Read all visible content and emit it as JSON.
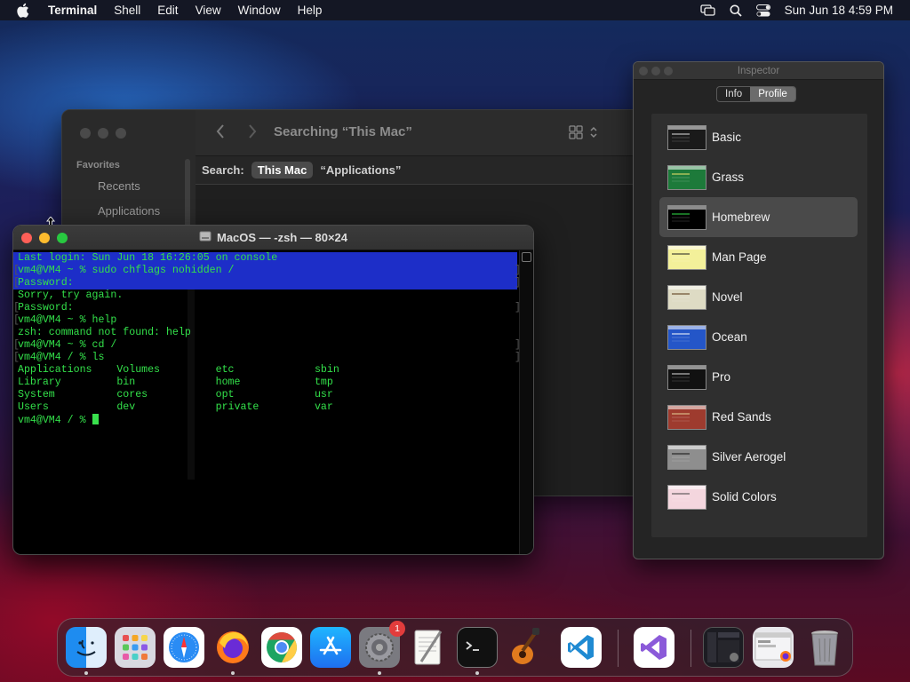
{
  "menubar": {
    "app_name": "Terminal",
    "items": [
      "Shell",
      "Edit",
      "View",
      "Window",
      "Help"
    ],
    "clock": "Sun Jun 18  4:59 PM"
  },
  "finder": {
    "title": "Searching “This Mac”",
    "sidebar_section": "Favorites",
    "sidebar_items": [
      "Recents",
      "Applications"
    ],
    "search_label": "Search:",
    "scope_selected": "This Mac",
    "scope_other": "“Applications”"
  },
  "terminal": {
    "title": "MacOS — -zsh — 80×24",
    "lines": [
      "Last login: Sun Jun 18 16:26:05 on console",
      "vm4@VM4 ~ % sudo chflags nohidden /",
      "Password:",
      "Sorry, try again.",
      "Password:",
      "vm4@VM4 ~ % help",
      "zsh: command not found: help",
      "vm4@VM4 ~ % cd /",
      "vm4@VM4 / % ls",
      "Applications    Volumes         etc             sbin",
      "Library         bin             home            tmp",
      "System          cores           opt             usr",
      "Users           dev             private         var",
      "vm4@VM4 / % "
    ],
    "selected_lines": [
      0,
      1,
      2
    ]
  },
  "inspector": {
    "title": "Inspector",
    "tabs": [
      "Info",
      "Profile"
    ],
    "active_tab": "Profile",
    "selected_profile": "Homebrew",
    "profiles": [
      {
        "name": "Basic",
        "bg": "#1a1a1a",
        "fg": "#e0e0e0"
      },
      {
        "name": "Grass",
        "bg": "#1d7a3a",
        "fg": "#f2e56b"
      },
      {
        "name": "Homebrew",
        "bg": "#000000",
        "fg": "#33e14a"
      },
      {
        "name": "Man Page",
        "bg": "#f3f09a",
        "fg": "#222222"
      },
      {
        "name": "Novel",
        "bg": "#dedbc4",
        "fg": "#553311"
      },
      {
        "name": "Ocean",
        "bg": "#2456c8",
        "fg": "#ffffff"
      },
      {
        "name": "Pro",
        "bg": "#111111",
        "fg": "#dddddd"
      },
      {
        "name": "Red Sands",
        "bg": "#9e3b2e",
        "fg": "#e6d39a"
      },
      {
        "name": "Silver Aerogel",
        "bg": "#8e8e8e",
        "fg": "#111111"
      },
      {
        "name": "Solid Colors",
        "bg": "#f4d6de",
        "fg": "#444444"
      }
    ]
  },
  "dock": {
    "apps": [
      {
        "name": "Finder",
        "icon": "finder-icon",
        "running": true
      },
      {
        "name": "Launchpad",
        "icon": "launchpad-icon",
        "running": false
      },
      {
        "name": "Safari",
        "icon": "safari-icon",
        "running": false
      },
      {
        "name": "Firefox",
        "icon": "firefox-icon",
        "running": true
      },
      {
        "name": "Chrome",
        "icon": "chrome-icon",
        "running": false
      },
      {
        "name": "App Store",
        "icon": "app-store-icon",
        "running": false
      },
      {
        "name": "System Preferences",
        "icon": "system-preferences-icon",
        "running": true,
        "badge": "1"
      },
      {
        "name": "TextEdit",
        "icon": "textedit-icon",
        "running": false
      },
      {
        "name": "Terminal",
        "icon": "terminal-icon",
        "running": true
      },
      {
        "name": "GarageBand",
        "icon": "garageband-icon",
        "running": false
      },
      {
        "name": "Visual Studio Code",
        "icon": "vscode-icon",
        "running": false
      },
      {
        "name": "Visual Studio",
        "icon": "visual-studio-icon",
        "running": false
      }
    ]
  }
}
